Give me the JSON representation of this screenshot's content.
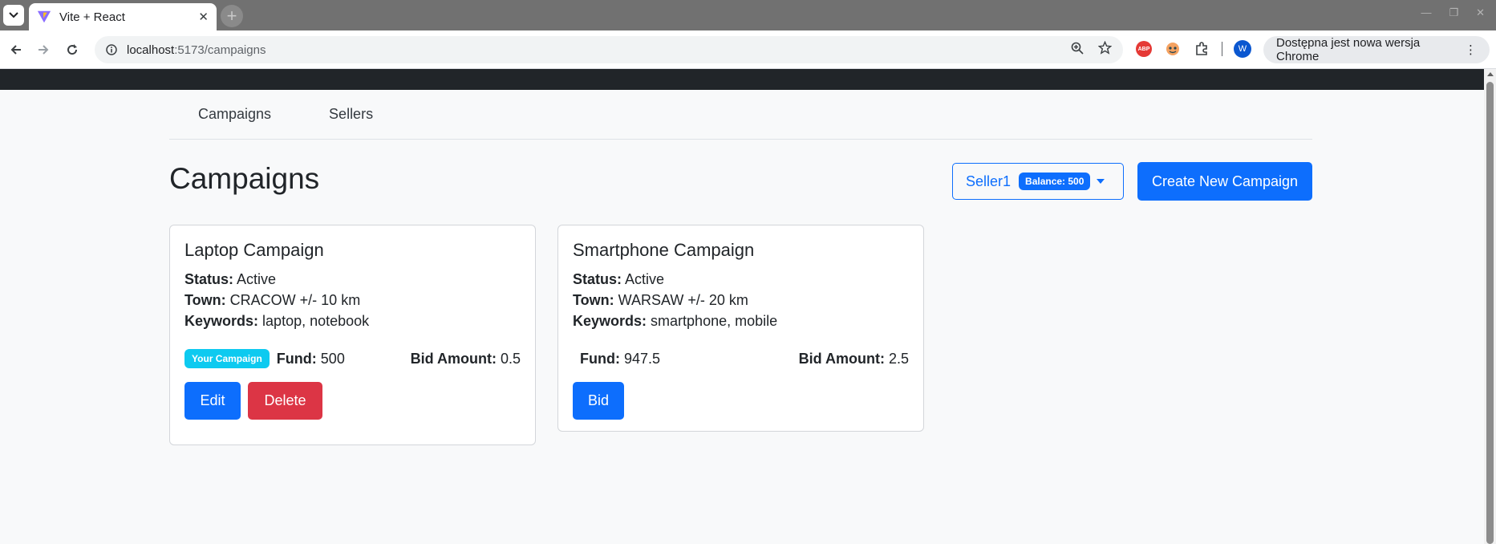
{
  "browser": {
    "tab_title": "Vite + React",
    "url_host": "localhost",
    "url_path": ":5173/campaigns",
    "update_text": "Dostępna jest nowa wersja Chrome",
    "profile_initial": "W",
    "abp_label": "ABP",
    "accent": "#0b57d0"
  },
  "nav": {
    "items": [
      {
        "label": "Campaigns"
      },
      {
        "label": "Sellers"
      }
    ]
  },
  "header": {
    "title": "Campaigns",
    "seller_name": "Seller1",
    "balance_label": "Balance: 500",
    "create_label": "Create New Campaign",
    "primary_color": "#0d6efd"
  },
  "labels": {
    "status": "Status:",
    "town": "Town:",
    "keywords": "Keywords:",
    "fund": "Fund:",
    "bid_amount": "Bid Amount:"
  },
  "campaigns": [
    {
      "name": "Laptop Campaign",
      "status": "Active",
      "town": "CRACOW +/- 10 km",
      "keywords": "laptop, notebook",
      "badge": "Your Campaign",
      "fund": "500",
      "bid_amount": "0.5",
      "edit_label": "Edit",
      "delete_label": "Delete"
    },
    {
      "name": "Smartphone Campaign",
      "status": "Active",
      "town": "WARSAW +/- 20 km",
      "keywords": "smartphone, mobile",
      "fund": "947.5",
      "bid_amount": "2.5",
      "bid_label": "Bid"
    }
  ]
}
